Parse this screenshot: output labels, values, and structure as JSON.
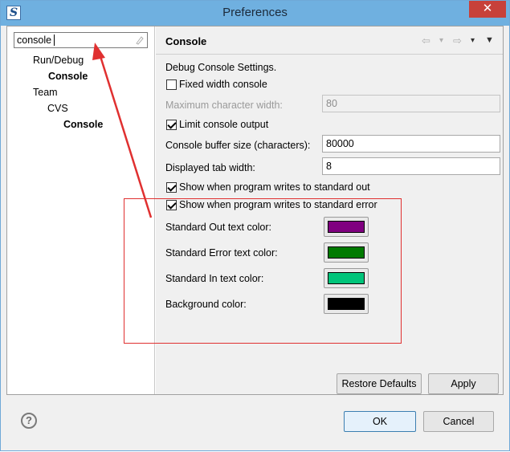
{
  "window": {
    "title": "Preferences",
    "app_icon": "S",
    "close_symbol": "✕"
  },
  "sidebar": {
    "search": {
      "value": "console",
      "clear_icon": "eraser-icon"
    },
    "items": [
      {
        "label": "Run/Debug",
        "bold": false
      },
      {
        "label": "Console",
        "bold": true,
        "selected": true
      },
      {
        "label": "Team",
        "bold": false
      },
      {
        "label": "CVS",
        "bold": false
      },
      {
        "label": "Console",
        "bold": true
      }
    ]
  },
  "page": {
    "title": "Console",
    "nav": {
      "back": "⇦",
      "dropdown": "▾",
      "forward": "⇨",
      "menu": "▼"
    },
    "description": "Debug Console Settings.",
    "fixed_width": {
      "label": "Fixed width console",
      "checked": false
    },
    "max_width": {
      "label": "Maximum character width:",
      "value": "80"
    },
    "limit_output": {
      "label": "Limit console output",
      "checked": true
    },
    "buffer_size": {
      "label": "Console buffer size (characters):",
      "value": "80000"
    },
    "tab_width": {
      "label": "Displayed tab width:",
      "value": "8"
    },
    "show_stdout": {
      "label": "Show when program writes to standard out",
      "checked": true
    },
    "show_stderr": {
      "label": "Show when program writes to standard error",
      "checked": true
    },
    "colors": [
      {
        "label": "Standard Out text color:",
        "color": "#800080"
      },
      {
        "label": "Standard Error text color:",
        "color": "#007a00"
      },
      {
        "label": "Standard In text color:",
        "color": "#00c47a"
      },
      {
        "label": "Background color:",
        "color": "#000000"
      }
    ],
    "restore_defaults": "Restore Defaults",
    "apply": "Apply"
  },
  "footer": {
    "help_symbol": "?",
    "ok": "OK",
    "cancel": "Cancel"
  },
  "annotation_color": "#e03030"
}
